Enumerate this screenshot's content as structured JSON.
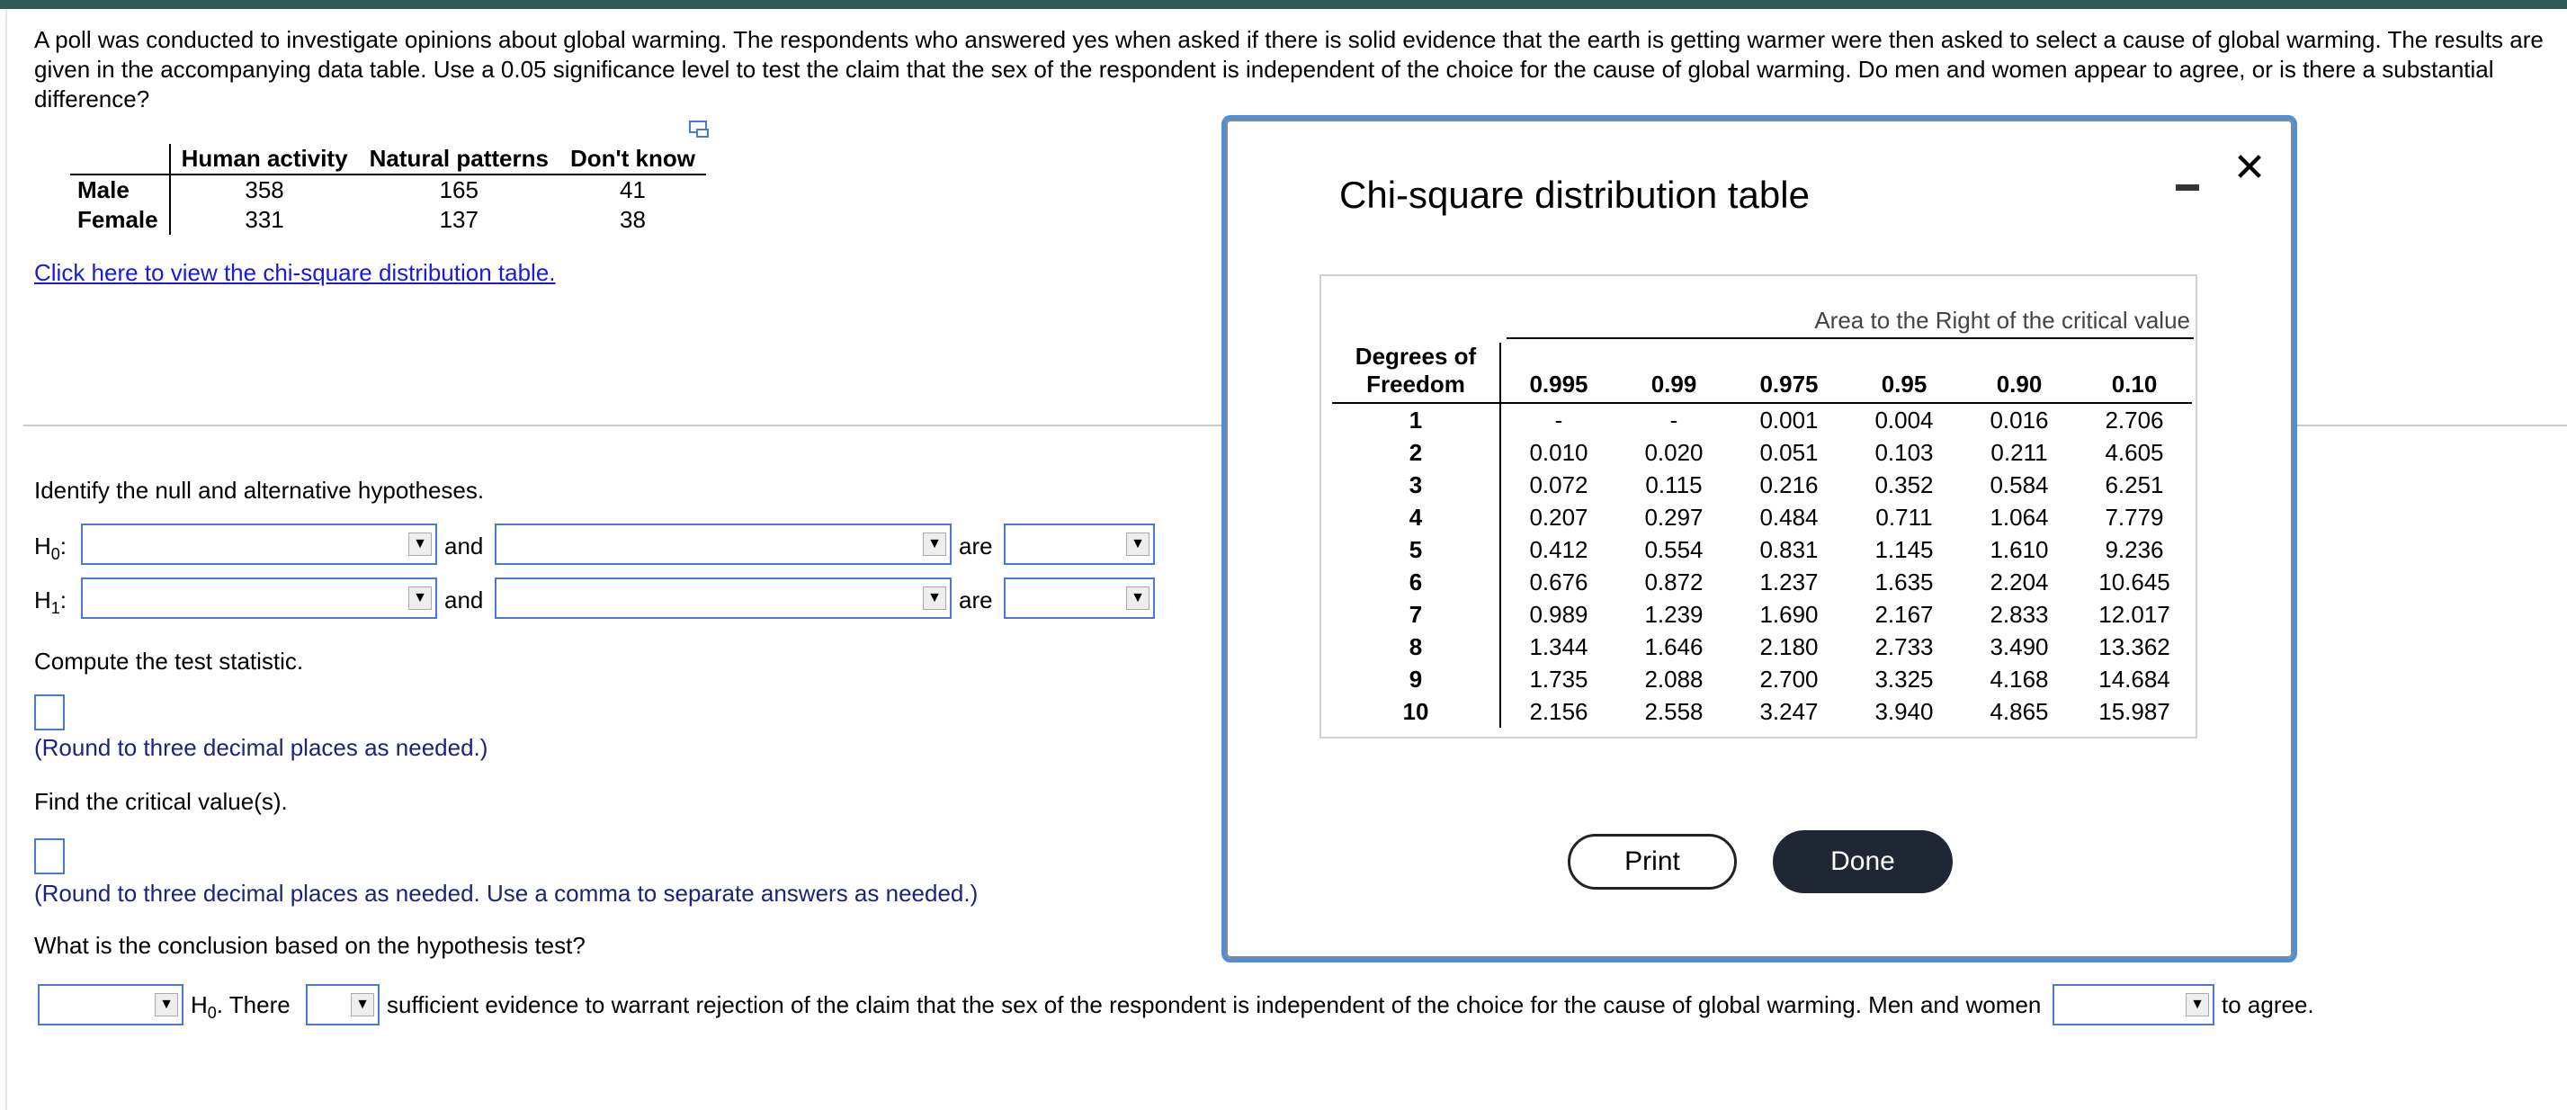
{
  "problem_text": "A poll was conducted to investigate opinions about global warming. The respondents who answered yes when asked if there is solid evidence that the earth is getting warmer were then asked to select a cause of global warming. The results are given in the accompanying data table. Use a 0.05 significance level to test the claim that the sex of the respondent is independent of the choice for the cause of global warming. Do men and women appear to agree, or is there a substantial difference?",
  "data_table": {
    "headers": [
      "Human activity",
      "Natural patterns",
      "Don't know"
    ],
    "rows": [
      {
        "label": "Male",
        "values": [
          "358",
          "165",
          "41"
        ]
      },
      {
        "label": "Female",
        "values": [
          "331",
          "137",
          "38"
        ]
      }
    ]
  },
  "link_text": "Click here to view the chi-square distribution table.",
  "hypotheses": {
    "prompt": "Identify the null and alternative hypotheses.",
    "h0": "H",
    "h0_sub": "0",
    "h1": "H",
    "h1_sub": "1",
    "colon": ":",
    "and": "and",
    "are": "are"
  },
  "test_statistic": {
    "prompt": "Compute the test statistic.",
    "hint": "(Round to three decimal places as needed.)"
  },
  "critical": {
    "prompt": "Find the critical value(s).",
    "hint": "(Round to three decimal places as needed. Use a comma to separate answers as needed.)"
  },
  "conclusion": {
    "prompt": "What is the conclusion based on the hypothesis test?",
    "h": "H",
    "h_sub": "0",
    "there": ". There",
    "middle": "sufficient evidence to warrant rejection of the claim that the sex of the respondent is independent of the choice for the cause of global warming. Men and women",
    "end": "to agree."
  },
  "modal": {
    "title": "Chi-square distribution table",
    "area_label": "Area to the Right of the critical value",
    "df_header_1": "Degrees of",
    "df_header_2": "Freedom",
    "columns": [
      "0.995",
      "0.99",
      "0.975",
      "0.95",
      "0.90",
      "0.10"
    ],
    "rows": [
      [
        "1",
        "-",
        "-",
        "0.001",
        "0.004",
        "0.016",
        "2.706"
      ],
      [
        "2",
        "0.010",
        "0.020",
        "0.051",
        "0.103",
        "0.211",
        "4.605"
      ],
      [
        "3",
        "0.072",
        "0.115",
        "0.216",
        "0.352",
        "0.584",
        "6.251"
      ],
      [
        "4",
        "0.207",
        "0.297",
        "0.484",
        "0.711",
        "1.064",
        "7.779"
      ],
      [
        "5",
        "0.412",
        "0.554",
        "0.831",
        "1.145",
        "1.610",
        "9.236"
      ],
      [
        "6",
        "0.676",
        "0.872",
        "1.237",
        "1.635",
        "2.204",
        "10.645"
      ],
      [
        "7",
        "0.989",
        "1.239",
        "1.690",
        "2.167",
        "2.833",
        "12.017"
      ],
      [
        "8",
        "1.344",
        "1.646",
        "2.180",
        "2.733",
        "3.490",
        "13.362"
      ],
      [
        "9",
        "1.735",
        "2.088",
        "2.700",
        "3.325",
        "4.168",
        "14.684"
      ],
      [
        "10",
        "2.156",
        "2.558",
        "3.247",
        "3.940",
        "4.865",
        "15.987"
      ]
    ],
    "print_label": "Print",
    "done_label": "Done",
    "close_glyph": "✕"
  },
  "dropdown_arrow": "▼"
}
